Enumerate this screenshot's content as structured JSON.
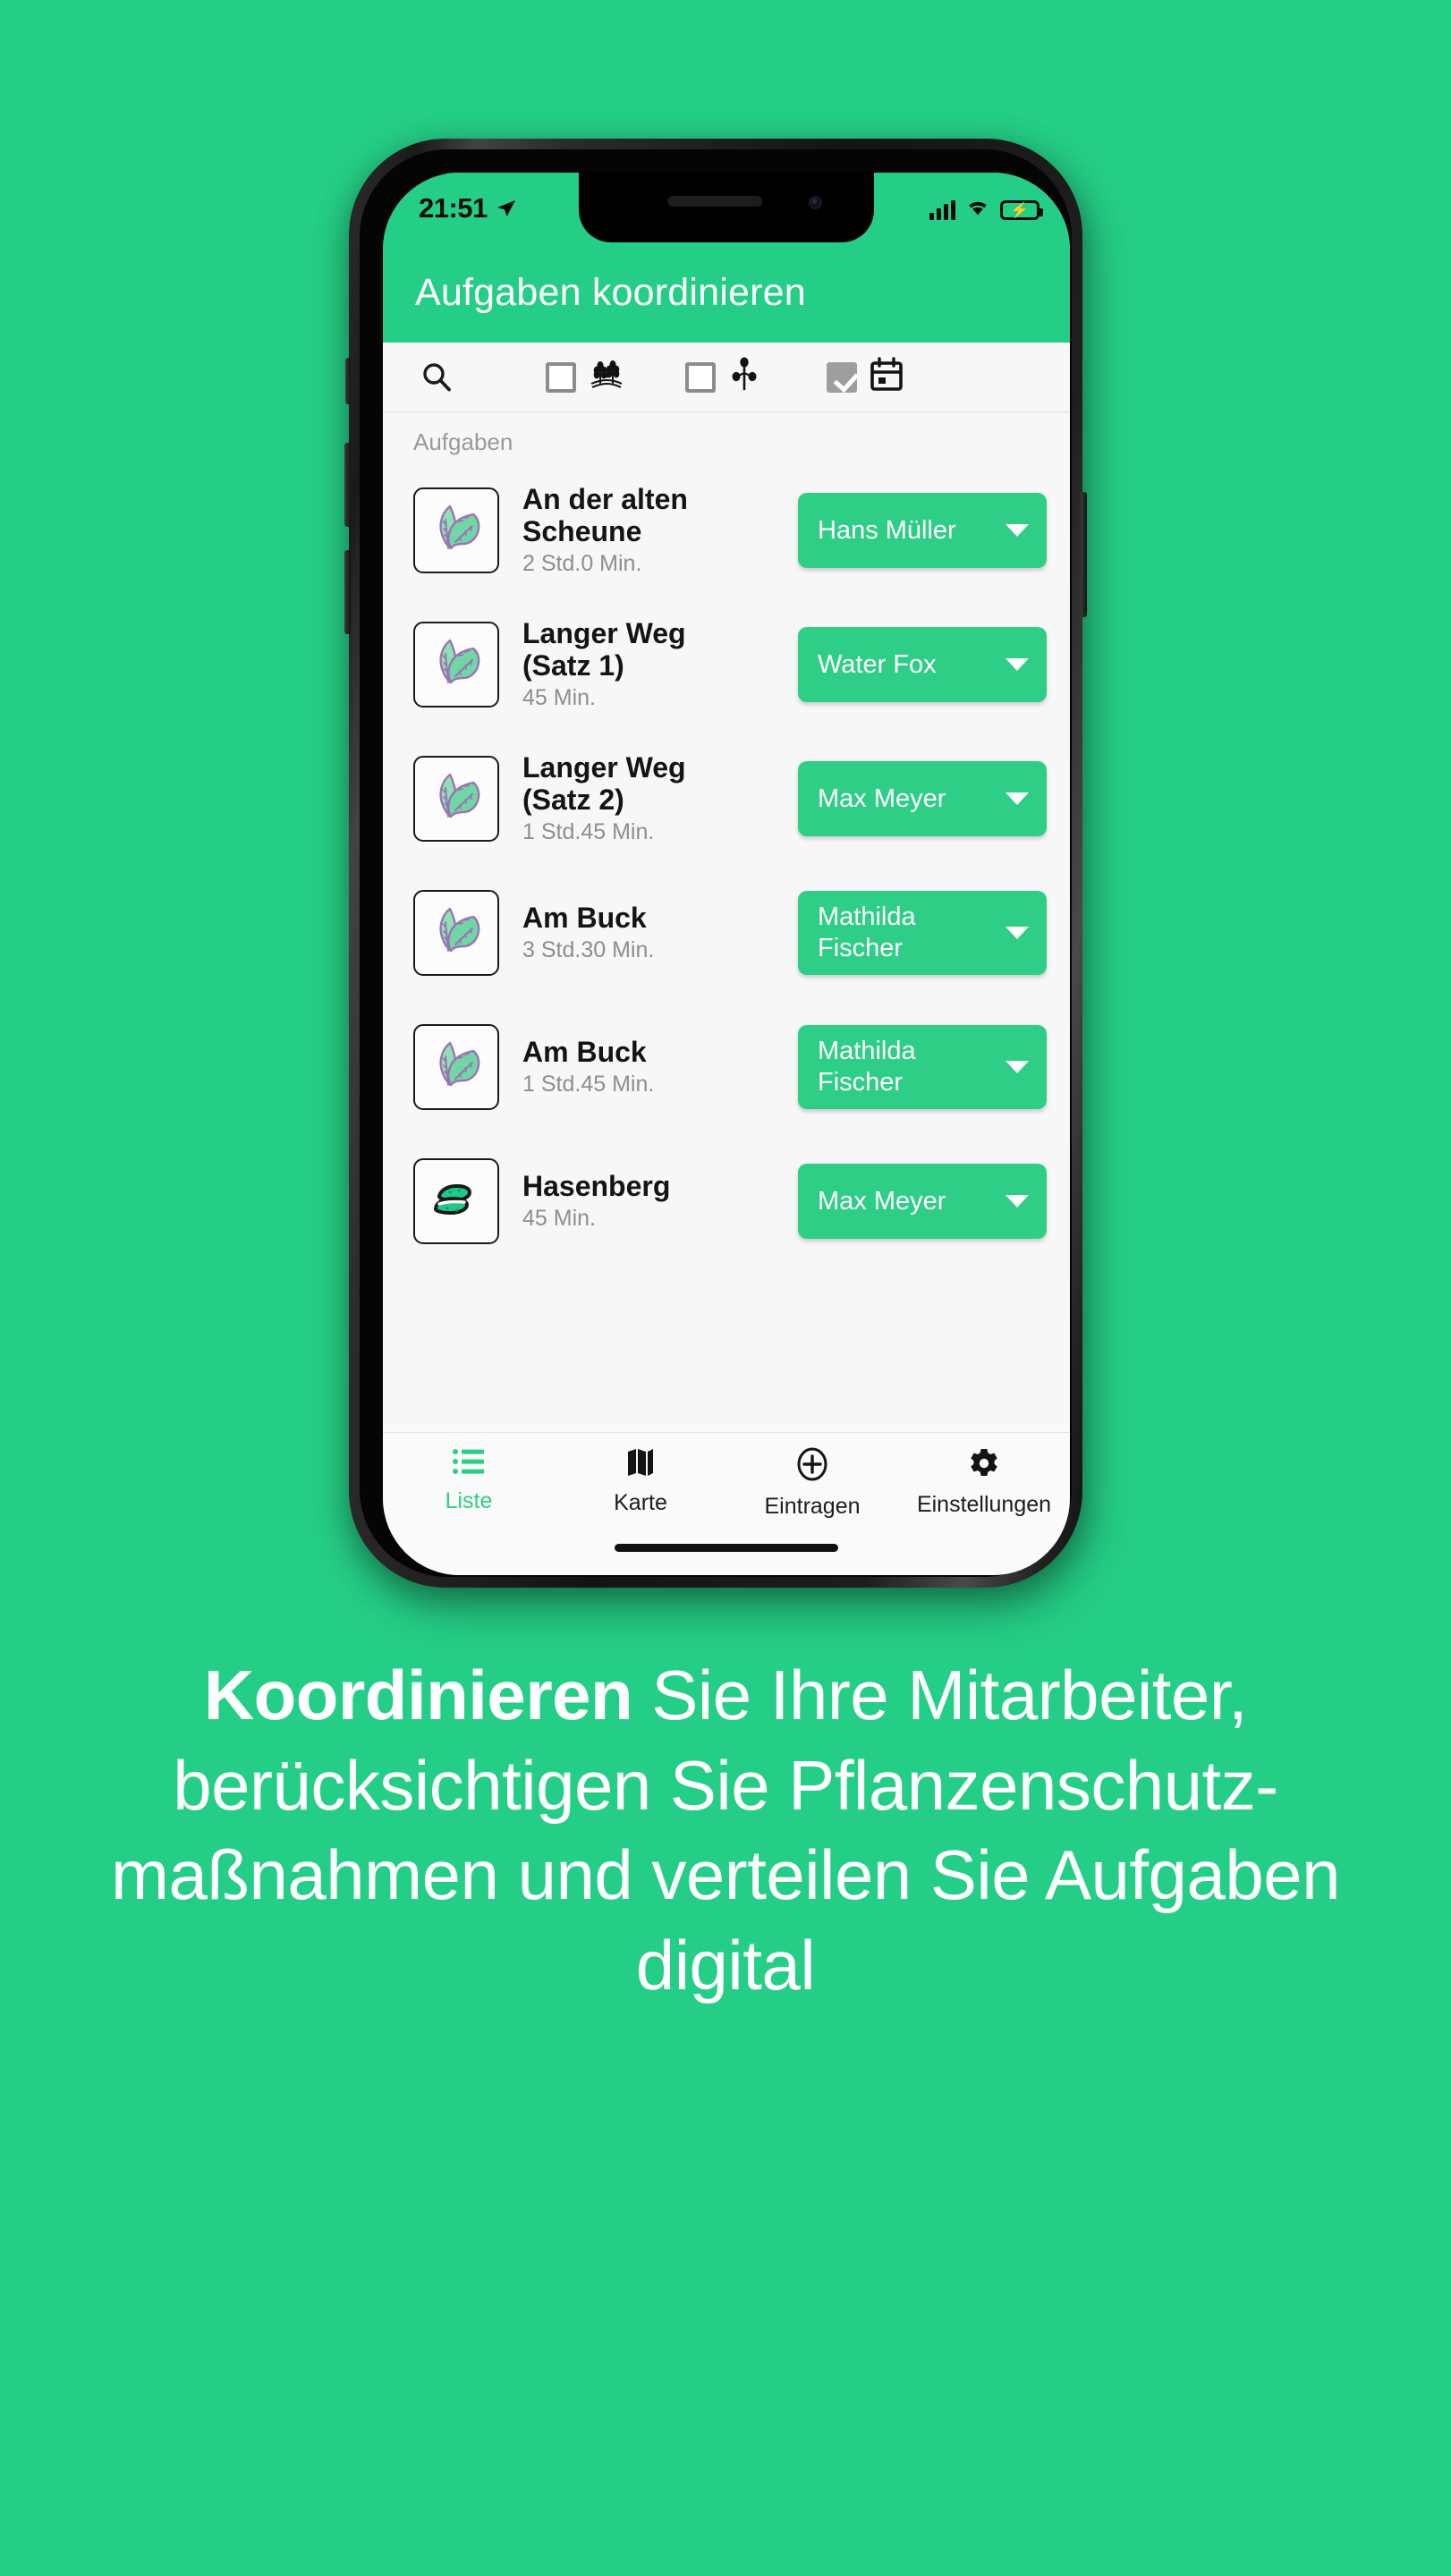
{
  "theme": {
    "background_green": "#25CE86",
    "accent_green": "#2ECE86",
    "screen_bg": "#f7f7f7"
  },
  "phone": {
    "status_bar": {
      "time": "21:51",
      "location_icon": "location-arrow-icon",
      "signal_icon": "cellular-signal-icon",
      "wifi_icon": "wifi-icon",
      "battery_icon": "battery-charging-icon"
    },
    "app_bar": {
      "title": "Aufgaben koordinieren"
    },
    "toolbar": {
      "search_icon": "search-icon",
      "items": [
        {
          "icon": "checkbox-unchecked-icon",
          "checked": false
        },
        {
          "icon": "wheat-field-icon"
        },
        {
          "icon": "checkbox-unchecked-icon",
          "checked": false
        },
        {
          "icon": "sprout-plant-icon"
        },
        {
          "icon": "checkbox-checked-icon",
          "checked": true
        },
        {
          "icon": "calendar-icon"
        }
      ]
    },
    "list": {
      "section_label": "Aufgaben",
      "rows": [
        {
          "thumb_icon": "leaves-icon",
          "title": "An der alten Scheune",
          "duration": "2 Std.0 Min.",
          "assignee": "Hans Müller"
        },
        {
          "thumb_icon": "leaves-icon",
          "title": "Langer Weg (Satz 1)",
          "duration": "45 Min.",
          "assignee": "Water Fox"
        },
        {
          "thumb_icon": "leaves-icon",
          "title": "Langer Weg (Satz 2)",
          "duration": "1 Std.45 Min.",
          "assignee": "Max Meyer"
        },
        {
          "thumb_icon": "leaves-icon",
          "title": "Am Buck",
          "duration": "3 Std.30 Min.",
          "assignee": "Mathilda Fischer"
        },
        {
          "thumb_icon": "leaves-icon",
          "title": "Am Buck",
          "duration": "1 Std.45 Min.",
          "assignee": "Mathilda Fischer"
        },
        {
          "thumb_icon": "cucumber-icon",
          "title": "Hasenberg",
          "duration": "45 Min.",
          "assignee": "Max Meyer"
        }
      ]
    },
    "bottom_nav": {
      "items": [
        {
          "label": "Liste",
          "icon": "list-icon",
          "active": true
        },
        {
          "label": "Karte",
          "icon": "map-icon",
          "active": false
        },
        {
          "label": "Eintragen",
          "icon": "plus-circle-icon",
          "active": false
        },
        {
          "label": "Einstellungen",
          "icon": "gear-icon",
          "active": false
        }
      ]
    }
  },
  "caption": {
    "bold_lead": "Koordinieren",
    "rest": " Sie Ihre Mitarbeiter, berücksichtigen Sie Pflanzenschutz-maßnahmen und verteilen Sie Aufgaben digital"
  }
}
